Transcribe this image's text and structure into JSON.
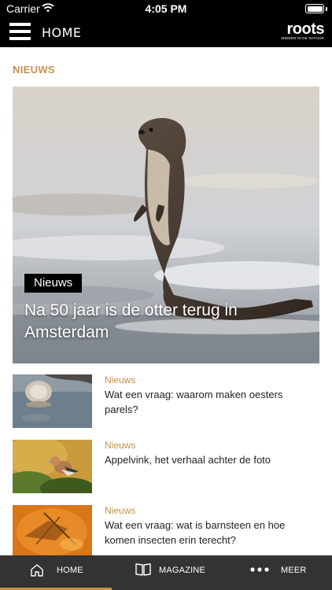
{
  "status": {
    "carrier": "Carrier",
    "time": "4:05 PM"
  },
  "header": {
    "title": "HOME",
    "logo_word": "roots",
    "logo_tagline": "MIDDEN IN DE NATUUR"
  },
  "section": {
    "title": "NIEUWS"
  },
  "hero": {
    "category": "Nieuws",
    "title": "Na 50 jaar is de otter terug in Amsterdam"
  },
  "articles": [
    {
      "category": "Nieuws",
      "title": "Wat een vraag: waarom maken oesters parels?"
    },
    {
      "category": "Nieuws",
      "title": "Appelvink, het verhaal achter de foto"
    },
    {
      "category": "Nieuws",
      "title": "Wat een vraag: wat is barnsteen en hoe komen insecten erin terecht?"
    }
  ],
  "tabs": {
    "home": "HOME",
    "magazine": "MAGAZINE",
    "more": "MEER"
  },
  "colors": {
    "accent": "#c8914e",
    "bar": "#000000",
    "tabbar": "#333333"
  }
}
